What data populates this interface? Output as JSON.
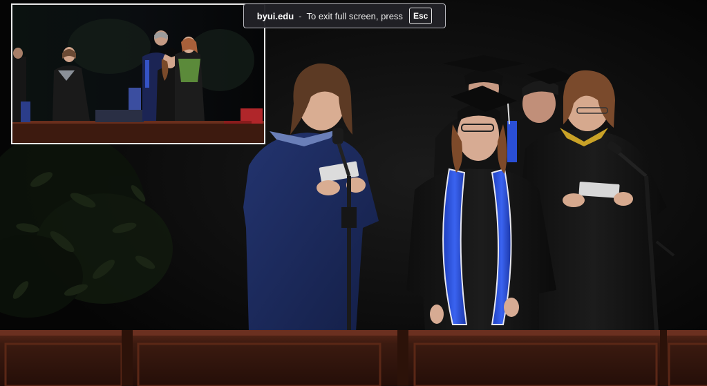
{
  "fullscreen_notice": {
    "domain": "byui.edu",
    "separator": "-",
    "message": "To exit full screen, press",
    "key": "Esc"
  },
  "video": {
    "main_view": "graduation-ceremony-stage",
    "inset_view": "stage-wide-shot"
  },
  "colors": {
    "stole_blue": "#2a4fd6",
    "navy_robe": "#1c2a5e",
    "black_robe": "#111111",
    "podium_wood": "#3a1810",
    "hood_gold": "#c9a227",
    "notice_background": "#212126"
  }
}
